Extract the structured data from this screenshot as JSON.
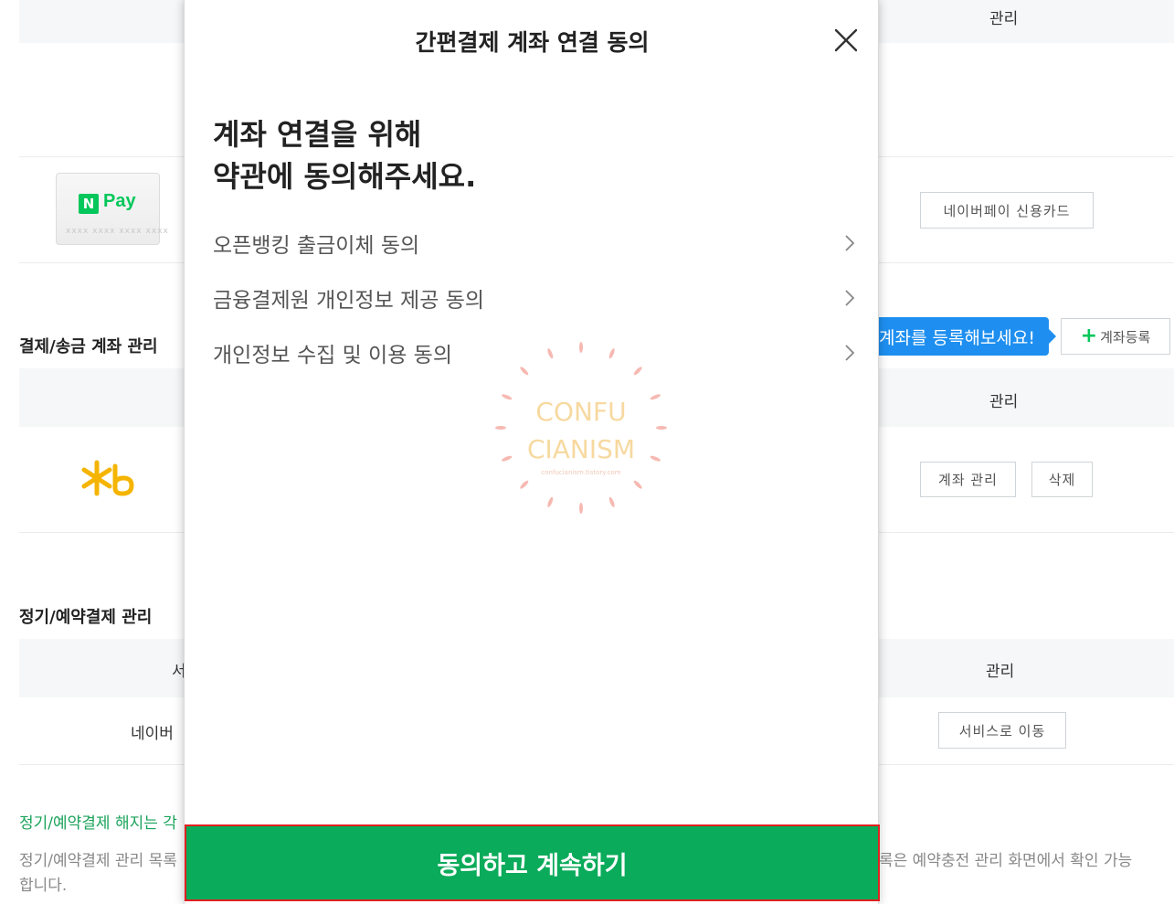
{
  "background": {
    "manage_header": "관리",
    "npay_card": {
      "logo_n": "N",
      "logo_pay": "Pay",
      "card_number_mask": "xxxx xxxx xxxx xxxx"
    },
    "npay_credit_card_button": "네이버페이 신용카드",
    "account_section_title": "결제/송금 계좌 관리",
    "register_tooltip": "계좌를 등록해보세요!",
    "add_account_button": "계좌등록",
    "account_manage_header": "관리",
    "account_manage_button": "계좌 관리",
    "delete_button": "삭제",
    "recurring_section_title": "정기/예약결제 관리",
    "recurring_col_service_partial": "서",
    "recurring_manage_header": "관리",
    "recurring_row_service_partial": "네이버",
    "go_to_service_button": "서비스로 이동",
    "note_green_partial": "정기/예약결제 해지는 각",
    "note_gray_left_partial": "정기/예약결제 관리 목록",
    "note_gray_right_partial": "록은 예약충전 관리 화면에서 확인 가능",
    "note_gray_line2": "합니다."
  },
  "modal": {
    "title": "간편결제 계좌 연결 동의",
    "headline_line1": "계좌 연결을 위해",
    "headline_line2": "약관에 동의해주세요.",
    "terms": [
      {
        "label": "오픈뱅킹 출금이체 동의"
      },
      {
        "label": "금융결제원 개인정보 제공 동의"
      },
      {
        "label": "개인정보 수집 및 이용 동의"
      }
    ],
    "watermark": {
      "line1": "CONFU",
      "line2": "CIANISM",
      "url": "confucianism.tistory.com"
    },
    "agree_button": "동의하고 계속하기"
  },
  "colors": {
    "accent_green": "#0aab5a",
    "npay_green": "#03c75a",
    "tooltip_blue": "#1e8ff0",
    "highlight_red": "#e02020"
  }
}
